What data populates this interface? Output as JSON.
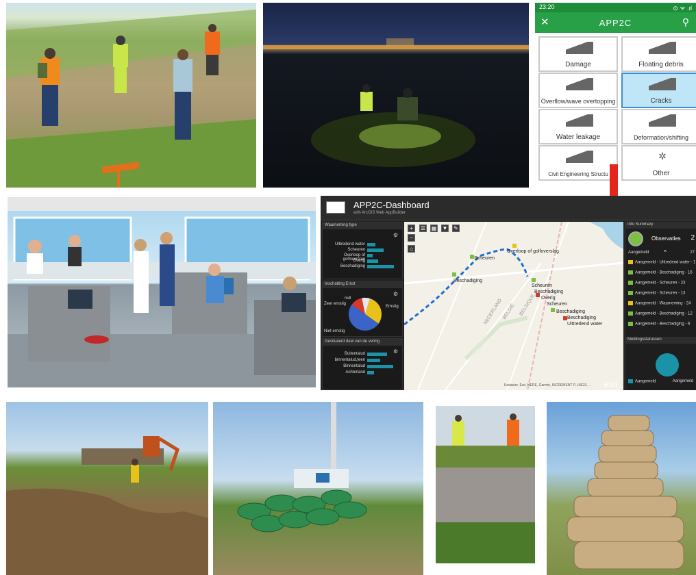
{
  "phone": {
    "time": "23:20",
    "status_right": "⊙ ᯤ .ıl",
    "app_title": "APP2C",
    "close": "✕",
    "cells": [
      {
        "label": "Damage",
        "selected": false
      },
      {
        "label": "Floating debris",
        "selected": false
      },
      {
        "label": "Overflow/wave overtopping",
        "selected": false
      },
      {
        "label": "Cracks",
        "selected": true
      },
      {
        "label": "Water leakage",
        "selected": false
      },
      {
        "label": "Deformation/shifting",
        "selected": false
      },
      {
        "label": "Civil Engineering Structu",
        "selected": false
      },
      {
        "label": "Other",
        "selected": false
      }
    ]
  },
  "dashboard": {
    "title": "APP2C-Dashboard",
    "subtitle": "with ArcGIS Web AppBuilder",
    "left_panels": [
      {
        "header": "Waarneming type",
        "bars": [
          {
            "label": "Uittredend water",
            "value": 18
          },
          {
            "label": "Scheuren",
            "value": 36
          },
          {
            "label": "Overloop of golfoverslag",
            "value": 12
          },
          {
            "label": "Overig",
            "value": 24
          },
          {
            "label": "Beschadiging",
            "value": 58
          }
        ]
      },
      {
        "header": "Inschatting Ernst",
        "pie": [
          {
            "label": "Ernstig",
            "value": 30,
            "color": "#e8c21a"
          },
          {
            "label": "Niet ernstig",
            "value": 50,
            "color": "#3a64c8"
          },
          {
            "label": "Zeer ernstig",
            "value": 12,
            "color": "#d73a2a"
          },
          {
            "label": "null",
            "value": 8,
            "color": "#e8e8e8"
          }
        ]
      },
      {
        "header": "Gesitueerd deel van de vering",
        "bars": [
          {
            "label": "Buitentalud",
            "value": 55
          },
          {
            "label": "binnentalud,teen",
            "value": 35
          },
          {
            "label": "Binnentalud",
            "value": 72
          },
          {
            "label": "Achterland",
            "value": 18
          }
        ]
      }
    ],
    "map_labels": [
      "Overloop of golfoverslag",
      "Scheuren",
      "Beschadiging",
      "Scheuren",
      "Beschadiging",
      "Overig",
      "Scheuren",
      "Beschadiging",
      "Beschadiging",
      "Uittredend water"
    ],
    "border_labels": [
      "NEDERLAND",
      "BELGIË",
      "BELGIQUE"
    ],
    "attribution": "Kadaster, Esri, HERE, Garmin, INCREMENT P, USGS, ...",
    "esri": "esri",
    "right_panel": {
      "header": "Info Summary",
      "title": "Observaties",
      "count": "2",
      "sub_left": "Aangemeld",
      "sub_right": "27",
      "items": [
        {
          "label": "Aangemeld - Uittredend water - 1",
          "color": "#e8c21a"
        },
        {
          "label": "Aangemeld - Beschadiging - 16",
          "color": "#7bc043"
        },
        {
          "label": "Aangemeld - Scheuren - 23",
          "color": "#7bc043"
        },
        {
          "label": "Aangemeld - Scheuren - 13",
          "color": "#7bc043"
        },
        {
          "label": "Aangemeld - Waarneming - 24",
          "color": "#e8c21a"
        },
        {
          "label": "Aangemeld - Beschadiging - 12",
          "color": "#7bc043"
        },
        {
          "label": "Aangemeld - Beschadiging - 6",
          "color": "#7bc043"
        }
      ],
      "status_header": "Meldingsstatussen",
      "legend": "Aangemeld",
      "legend_right": "Aangemeld"
    }
  },
  "colors": {
    "accent_green": "#27a047",
    "selected_blue": "#bfe6f7",
    "arrow_red": "#e5261e",
    "dashboard_bar": "#1a93a8"
  }
}
